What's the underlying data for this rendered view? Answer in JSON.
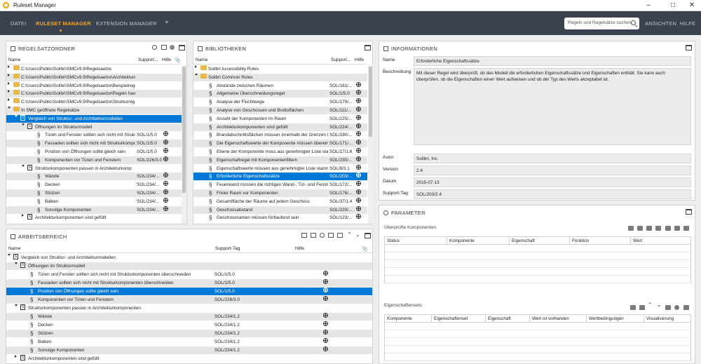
{
  "window": {
    "title": "Ruleset Manager"
  },
  "menu": {
    "datei": "DATEI",
    "ruleset_manager": "RULESET MANAGER",
    "extension_manager": "EXTENSION MANAGER",
    "plus": "+",
    "search_placeholder": "Regeln und Regelsätze suchen",
    "ansichten": "ANSICHTEN",
    "hilfe": "HILFE"
  },
  "colors": {
    "accent": "#f5a623",
    "selection": "#0078d7",
    "menubar": "#3a4250"
  },
  "regelsatzordner": {
    "title": "REGELSATZORDNER",
    "columns": {
      "name": "Name",
      "support": "Support...",
      "hilfe": "Hilfe"
    },
    "rows": [
      {
        "text": "C:\\Users\\Public\\Solibri\\SMCv9.9\\Regelsaetze",
        "support": "",
        "hilfe": false
      },
      {
        "text": "C:\\Users\\Public\\Solibri\\SMCv9.9\\Regelsaetze\\Architekturre",
        "support": "",
        "hilfe": false
      },
      {
        "text": "C:\\Users\\Public\\Solibri\\SMCv9.9\\Regelsaetze\\Beispielregel",
        "support": "",
        "hilfe": false
      },
      {
        "text": "C:\\Users\\Public\\Solibri\\SMCv9.9\\Regelsaetze\\Regeln fuer",
        "support": "",
        "hilfe": false
      },
      {
        "text": "C:\\Users\\Public\\Solibri\\SMCv9.9\\Regelsaetze\\Strukturreg",
        "support": "",
        "hilfe": false
      },
      {
        "text": "In SMC geöffnete Regelsätze",
        "support": "",
        "hilfe": false
      },
      {
        "text": "Vergleich von Struktur- und Architekturmodellen",
        "support": "",
        "hilfe": false
      },
      {
        "text": "Öffnungen im Strukturmodell",
        "support": "",
        "hilfe": false
      },
      {
        "text": "Türen und Fenster sollten sich nicht mit Strukt",
        "support": "SOL/1/5.0",
        "hilfe": true
      },
      {
        "text": "Fassaden sollten sich nicht mit Strukturkompo",
        "support": "SOL/1/5.0",
        "hilfe": true
      },
      {
        "text": "Position von Öffnungen sollte gleich sein",
        "support": "SOL/1/5.0",
        "hilfe": true
      },
      {
        "text": "Komponenten vor Türen und Fenstern",
        "support": "SOL/226/3.0",
        "hilfe": true
      },
      {
        "text": "Strukturkomponenten passen in Architekturkomp",
        "support": "",
        "hilfe": false
      },
      {
        "text": "Wände",
        "support": "SOL/234/...",
        "hilfe": true
      },
      {
        "text": "Decken",
        "support": "SOL/234/...",
        "hilfe": true
      },
      {
        "text": "Stützen",
        "support": "SOL/234/...",
        "hilfe": true
      },
      {
        "text": "Balken",
        "support": "SOL/234/...",
        "hilfe": true
      },
      {
        "text": "Sonstige Komponenten",
        "support": "SOL/234/...",
        "hilfe": true
      },
      {
        "text": "Architekturkomponenten sind gefüllt",
        "support": "",
        "hilfe": false
      }
    ]
  },
  "bibliotheken": {
    "title": "BIBLIOTHEKEN",
    "columns": {
      "name": "Name",
      "support": "Support...",
      "hilfe": "Hilfe"
    },
    "rows": [
      {
        "text": "Solibri Accessibility Rules",
        "support": "",
        "hilfe": false
      },
      {
        "text": "Solibri Common Rules",
        "support": "",
        "hilfe": false
      },
      {
        "text": "Abstände zwischen Räumen",
        "support": "SOL/161/...",
        "hilfe": true
      },
      {
        "text": "Allgemeine Überschneidungsregel",
        "support": "SOL/1/5.0",
        "hilfe": true
      },
      {
        "text": "Analyse der Fluchtwege",
        "support": "SOL/179/...",
        "hilfe": true
      },
      {
        "text": "Analyse von Geschossen und Bruttoflächen",
        "support": "SOL/111/...",
        "hilfe": true
      },
      {
        "text": "Anzahl der Komponenten im Raum",
        "support": "SOL/225/...",
        "hilfe": true
      },
      {
        "text": "Architekturkomponenten sind gefüllt",
        "support": "SOL/224/...",
        "hilfe": true
      },
      {
        "text": "Brandabschnittsflächen müssen innerhalb der Grenzen li",
        "support": "SOL/190/...",
        "hilfe": true
      },
      {
        "text": "Die Eigenschaftswerte der Komponente müssen überein",
        "support": "SOL/171/...",
        "hilfe": true
      },
      {
        "text": "Ebene der Komponente muss aus genehmigter Liste stam",
        "support": "SOL/17/1.6",
        "hilfe": true
      },
      {
        "text": "Eigenschaftregel mit Komponentenfiltern",
        "support": "SOL/230/...",
        "hilfe": true
      },
      {
        "text": "Eigenschaftswerte müssen aus genehmigter Liste stamme",
        "support": "SOL/9/3.1",
        "hilfe": true
      },
      {
        "text": "Erforderliche Eigenschaftssätze",
        "support": "SOL/203/...",
        "hilfe": true
      },
      {
        "text": "Feuerwand müssen die richtigen Wand-, Tür- und Fenste",
        "support": "SOL/172/...",
        "hilfe": true
      },
      {
        "text": "Freier Raum vor Komponenten",
        "support": "SOL/176/...",
        "hilfe": true
      },
      {
        "text": "Gesamtfläche der Räume auf jedem Geschoss",
        "support": "SOL/37/1.4",
        "hilfe": true
      },
      {
        "text": "Geschossabstand",
        "support": "SOL/220/...",
        "hilfe": true
      },
      {
        "text": "Geschossnamen müssen fortlaufend sein",
        "support": "SOL/123/...",
        "hilfe": true
      }
    ]
  },
  "arbeitsbereich": {
    "title": "ARBEITSBEREICH",
    "columns": {
      "name": "Name",
      "support": "Support-Tag",
      "hilfe": "Hilfe"
    },
    "rows": [
      {
        "text": "Vergleich von Struktur- und Architekturmodellen",
        "support": "",
        "hilfe": false
      },
      {
        "text": "Öffnungen im Strukturmodell",
        "support": "",
        "hilfe": false
      },
      {
        "text": "Türen und Fenster sollten sich nicht mit Strukturkomponenten überschneiden",
        "support": "SOL/1/5.0",
        "hilfe": true
      },
      {
        "text": "Fassaden sollten sich nicht mit Strukturkomponenten überschneiden",
        "support": "SOL/1/5.0",
        "hilfe": true
      },
      {
        "text": "Position von Öffnungen sollte gleich sein",
        "support": "SOL/1/5.0",
        "hilfe": true
      },
      {
        "text": "Komponenten vor Türen und Fenstern",
        "support": "SOL/226/3.0",
        "hilfe": true
      },
      {
        "text": "Strukturkomponenten passen in Architekturkomponenten",
        "support": "",
        "hilfe": false
      },
      {
        "text": "Wände",
        "support": "SOL/234/1.2",
        "hilfe": true
      },
      {
        "text": "Decken",
        "support": "SOL/234/1.2",
        "hilfe": true
      },
      {
        "text": "Stützen",
        "support": "SOL/234/1.2",
        "hilfe": true
      },
      {
        "text": "Balken",
        "support": "SOL/234/1.2",
        "hilfe": true
      },
      {
        "text": "Sonstige Komponenten",
        "support": "SOL/234/1.2",
        "hilfe": true
      },
      {
        "text": "Architekturkomponenten sind gefüllt",
        "support": "",
        "hilfe": false
      }
    ]
  },
  "informationen": {
    "title": "INFORMATIONEN",
    "name_label": "Name",
    "name_value": "Erforderliche Eigenschaftssätze",
    "beschreibung_label": "Beschreibung",
    "beschreibung_value": "Mit dieser Regel wird überprüft, ob das Modell die erforderlichen Eigenschaftssätze und Eigenschaften enthält. Sie kann auch überprüfen, ob die Eigenschaften einen Wert aufweisen und ob der Typ des Werts akzeptabel ist.",
    "autor_label": "Autor",
    "autor_value": "Solibri, Inc.",
    "version_label": "Version",
    "version_value": "2.4",
    "datum_label": "Datum",
    "datum_value": "2015-07-13",
    "support_label": "Support-Tag",
    "support_value": "SOL/203/2.4"
  },
  "parameter": {
    "title": "PARAMETER",
    "komponenten_label": "Überprüfte Komponenten",
    "komponenten_columns": [
      "Status",
      "Komponente",
      "Eigenschaft",
      "Funktion",
      "Wert"
    ],
    "eigenschaftssets_label": "Eigenschaftensets",
    "eigenschaftssets_columns": [
      "Komponente",
      "Eigenschaftenset",
      "Eigenschaft",
      "Wert ist vorhanden",
      "Wertbedingungen",
      "Visualisierung"
    ]
  }
}
